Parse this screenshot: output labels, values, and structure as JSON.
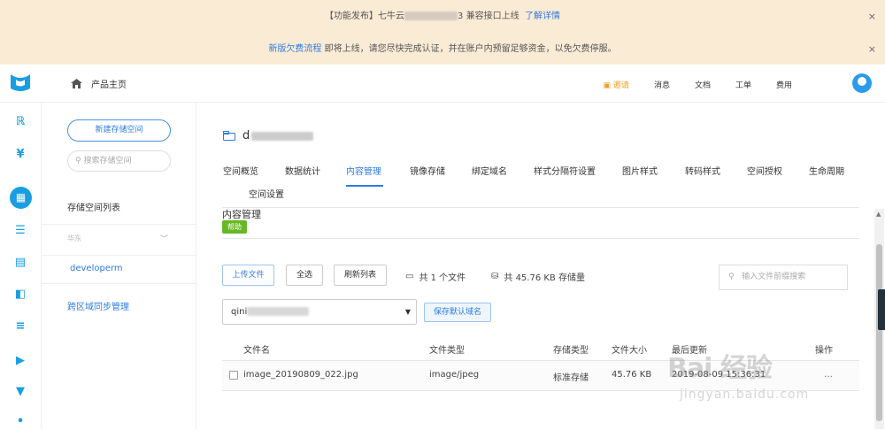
{
  "banners": [
    {
      "prefix": "【功能发布】七牛云",
      "suffix": "3 兼容接口上线",
      "link": "了解详情",
      "close": "×"
    },
    {
      "link": "新版欠费流程",
      "text": "即将上线，请您尽快完成认证，并在账户内预留足够资金，以免欠费停服。",
      "close": "×"
    }
  ],
  "topbar": {
    "home_label": "产品主页",
    "nav": [
      "邀请",
      "消息",
      "文档",
      "工单",
      "费用"
    ]
  },
  "sidebar": {
    "icons": [
      "rtc-icon",
      "yen-icon",
      "storage-icon",
      "cdn-icon",
      "live-icon",
      "media-icon",
      "settings-icon",
      "video-icon",
      "filter-icon"
    ]
  },
  "panel": {
    "new_button": "新建存储空间",
    "search_placeholder": "搜索存储空间",
    "list_title": "存储空间列表",
    "region": "华东",
    "bucket": "developerm",
    "cross_region": "跨区域同步管理"
  },
  "main": {
    "bucket_initial": "d",
    "tabs": [
      "空间概览",
      "数据统计",
      "内容管理",
      "镜像存储",
      "绑定域名",
      "样式分隔符设置",
      "图片样式",
      "转码样式",
      "空间授权",
      "生命周期",
      "空间设置"
    ],
    "active_tab": "内容管理",
    "section_title": "内容管理",
    "help": "帮助",
    "buttons": {
      "upload": "上传文件",
      "select_all": "全选",
      "refresh": "刷新列表"
    },
    "file_count": "共 1 个文件",
    "storage_total": "共 45.76 KB 存储量",
    "search_placeholder": "输入文件前缀搜索",
    "domain_prefix": "qini",
    "save_domain": "保存默认域名",
    "table": {
      "headers": [
        "文件名",
        "文件类型",
        "存储类型",
        "文件大小",
        "最后更新",
        "操作"
      ],
      "rows": [
        {
          "name": "image_20190809_022.jpg",
          "type": "image/jpeg",
          "storage": "标准存储",
          "size": "45.76 KB",
          "updated": "2019-08-09 15:36:31",
          "action": "…"
        }
      ]
    }
  },
  "watermark": {
    "big": "Bai 经验",
    "small": "jingyan.baidu.com"
  }
}
